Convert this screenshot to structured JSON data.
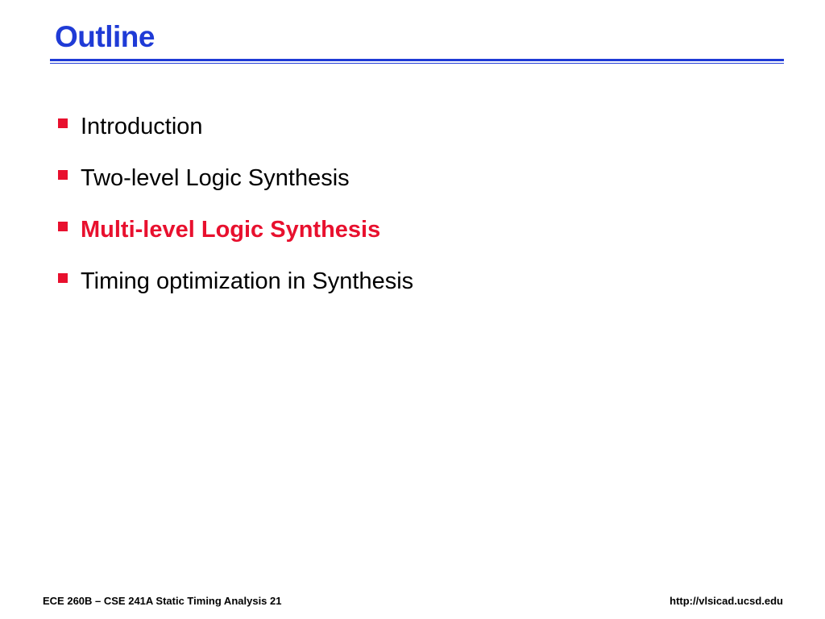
{
  "slide": {
    "title": "Outline",
    "colors": {
      "title": "#1f3bd6",
      "rule": "#1f3bd6",
      "bullet_marker": "#e8102e",
      "highlight_text": "#e8102e",
      "normal_text": "#000000"
    },
    "bullets": [
      {
        "text": "Introduction",
        "highlighted": false
      },
      {
        "text": "Two-level Logic Synthesis",
        "highlighted": false
      },
      {
        "text": "Multi-level Logic Synthesis",
        "highlighted": true
      },
      {
        "text": "Timing optimization in Synthesis",
        "highlighted": false
      }
    ]
  },
  "footer": {
    "left": "ECE 260B – CSE 241A Static Timing Analysis 21",
    "right": "http://vlsicad.ucsd.edu"
  }
}
